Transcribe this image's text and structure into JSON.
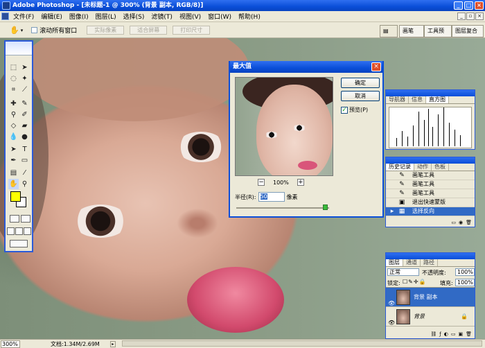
{
  "window": {
    "title": "Adobe Photoshop - [未标题-1 @ 300% (背景 副本, RGB/8)]",
    "min": "_",
    "max": "□",
    "close": "×"
  },
  "menu": [
    "文件(F)",
    "编辑(E)",
    "图像(I)",
    "图层(L)",
    "选择(S)",
    "滤镜(T)",
    "视图(V)",
    "窗口(W)",
    "帮助(H)"
  ],
  "options": {
    "scroll_all": "滚动所有窗口",
    "actual_pixels": "实际像素",
    "fit_screen": "适合屏幕",
    "print_size": "打印尺寸"
  },
  "wells": [
    "画笔",
    "工具预设",
    "图层复合"
  ],
  "dialog": {
    "title": "最大值",
    "ok": "确定",
    "cancel": "取消",
    "preview_label": "预览(P)",
    "preview_checked": true,
    "zoom": "100%",
    "zoom_out": "−",
    "zoom_in": "+",
    "radius_label": "半径(R):",
    "radius_value": "50",
    "radius_unit": "像素",
    "slider_fraction": 0.96
  },
  "nav_panel": {
    "tabs": [
      "导航器",
      "信息",
      "直方图"
    ],
    "active": 2
  },
  "history_panel": {
    "tabs": [
      "历史记录",
      "动作",
      "色板"
    ],
    "items": [
      "画笔工具",
      "画笔工具",
      "画笔工具",
      "退出快速蒙版",
      "选择反向"
    ],
    "selected": 4
  },
  "layers_panel": {
    "tabs": [
      "图层",
      "通道",
      "路径"
    ],
    "blend_mode": "正常",
    "opacity_label": "不透明度:",
    "opacity": "100%",
    "lock_label": "锁定:",
    "fill_label": "填充:",
    "fill": "100%",
    "layers": [
      {
        "name": "背景 副本",
        "selected": true,
        "locked": false
      },
      {
        "name": "背景",
        "selected": false,
        "locked": true
      }
    ]
  },
  "status": {
    "zoom": "300%",
    "doc": "文档:1.34M/2.69M"
  },
  "colors": {
    "foreground": "#ffff00",
    "background": "#ffffff",
    "selection": "#316ac5"
  }
}
